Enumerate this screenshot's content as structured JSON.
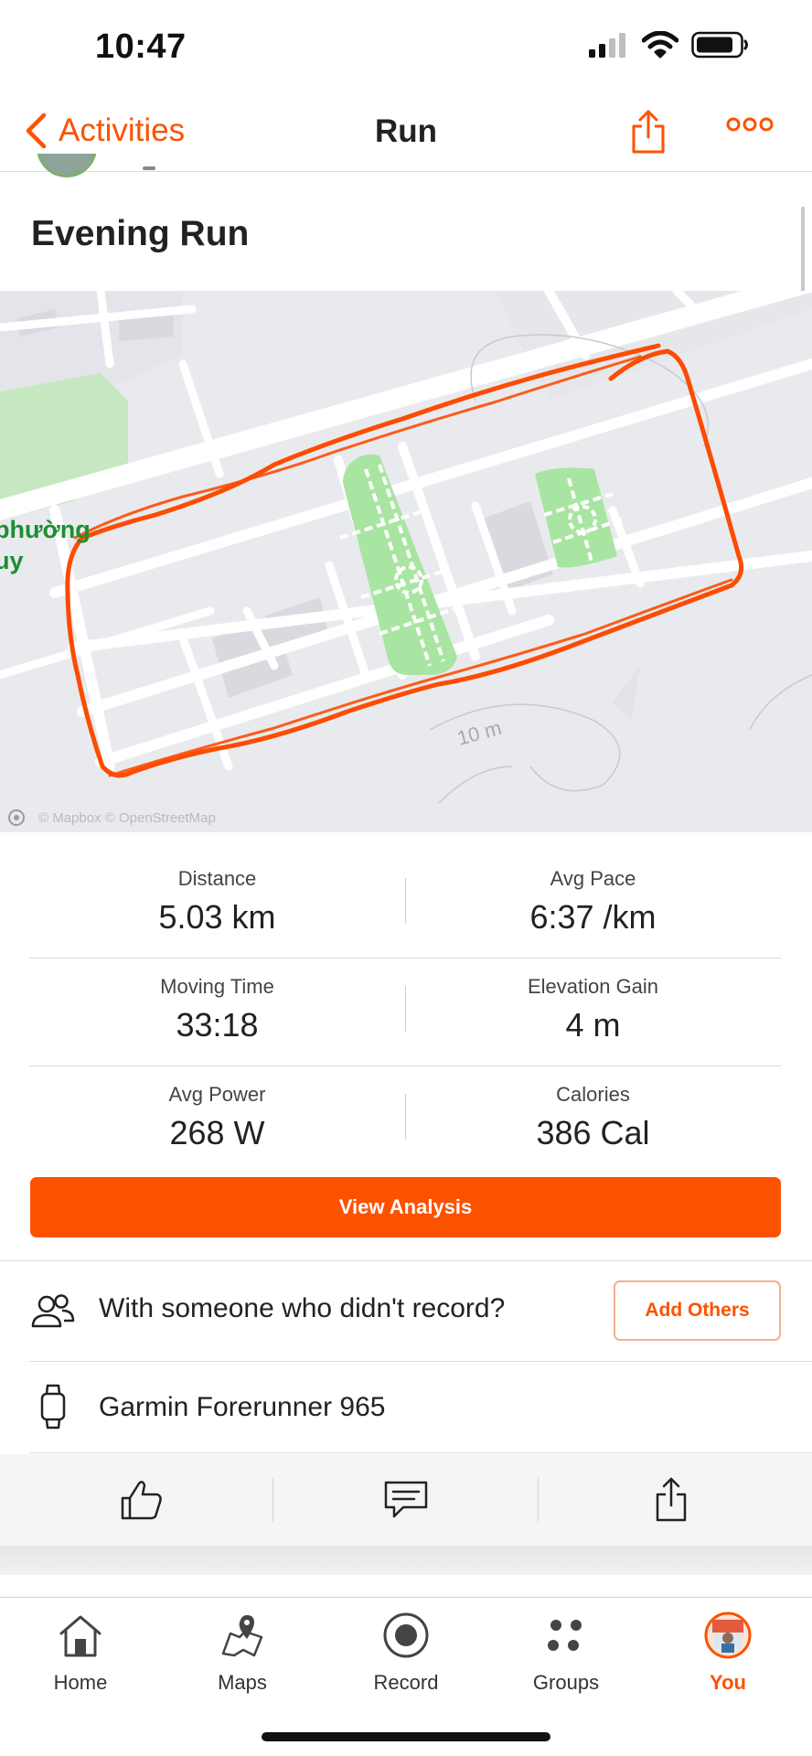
{
  "status_bar": {
    "time": "10:47"
  },
  "nav": {
    "back_label": "Activities",
    "title": "Run"
  },
  "activity": {
    "title": "Evening Run"
  },
  "map": {
    "attribution": "© Mapbox © OpenStreetMap",
    "place_label_line1": "phường",
    "place_label_line2": "uy",
    "contour_label": "10 m",
    "route_color": "#fc4c02"
  },
  "stats": [
    {
      "label": "Distance",
      "value": "5.03 km"
    },
    {
      "label": "Avg Pace",
      "value": "6:37 /km"
    },
    {
      "label": "Moving Time",
      "value": "33:18"
    },
    {
      "label": "Elevation Gain",
      "value": "4 m"
    },
    {
      "label": "Avg Power",
      "value": "268 W"
    },
    {
      "label": "Calories",
      "value": "386 Cal"
    }
  ],
  "buttons": {
    "view_analysis": "View Analysis",
    "add_others": "Add Others"
  },
  "rows": {
    "with_someone": "With someone who didn't record?",
    "device": "Garmin Forerunner 965"
  },
  "actions": [
    {
      "icon": "thumbs-up-icon"
    },
    {
      "icon": "comment-icon"
    },
    {
      "icon": "share-icon"
    }
  ],
  "tabs": [
    {
      "label": "Home",
      "icon": "home-icon"
    },
    {
      "label": "Maps",
      "icon": "maps-icon"
    },
    {
      "label": "Record",
      "icon": "record-icon"
    },
    {
      "label": "Groups",
      "icon": "groups-icon"
    },
    {
      "label": "You",
      "icon": "avatar",
      "active": true
    }
  ],
  "colors": {
    "accent": "#fc5200",
    "park_green": "#a9e5a2",
    "map_bg": "#e9eaee"
  }
}
